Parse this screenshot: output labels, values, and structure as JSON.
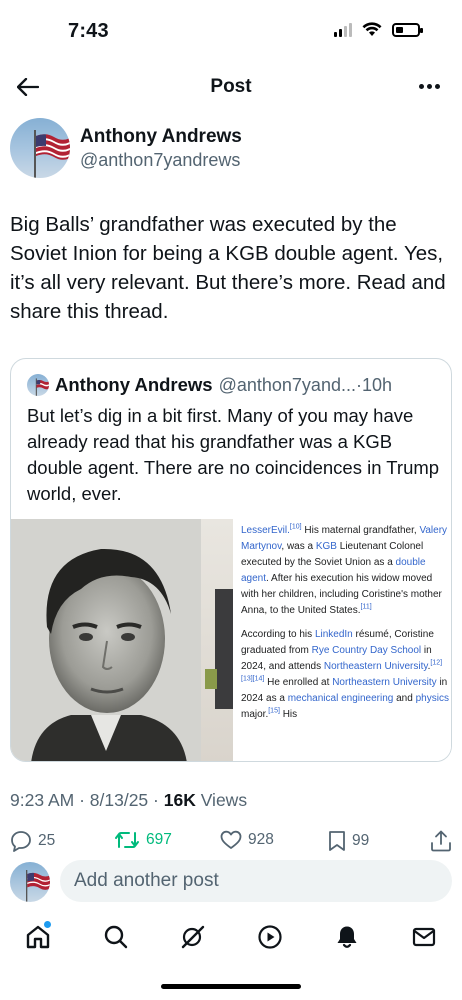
{
  "status_bar": {
    "time": "7:43",
    "battery_level": 0.35
  },
  "header": {
    "title": "Post",
    "back_icon": "arrow-left-icon",
    "more_icon": "more-dots-icon"
  },
  "author": {
    "name": "Anthony Andrews",
    "handle": "@anthon7yandrews"
  },
  "post": {
    "text": "Big Balls’ grandfather was executed by the Soviet Inion for being a KGB double agent. Yes, it’s all very relevant. But there’s more. Read and share this thread."
  },
  "quote": {
    "name": "Anthony Andrews",
    "handle": "@anthon7yand...",
    "separator": "·",
    "time": "10h",
    "text": "But let’s dig in a bit first. Many of you may have already read that his grandfather was a KGB double agent. There are no coincidences in Trump world, ever.",
    "wiki": {
      "p1": {
        "a": "LesserEvil.",
        "s1": "[10]",
        "b": " His maternal grandfather, ",
        "c": "Valery Martynov",
        "d": ", was a ",
        "e": "KGB",
        "f": " Lieutenant Colonel executed by the Soviet Union as a ",
        "g": "double agent",
        "h": ". After his execution his widow moved with her children, including Coristine's mother Anna, to the United States.",
        "s2": "[11]"
      },
      "p2": {
        "a": "According to his ",
        "b": "LinkedIn",
        "c": " résumé, Coristine graduated from ",
        "d": "Rye Country Day School",
        "e": " in 2024, and attends ",
        "f": "Northeastern University",
        "g": ".",
        "s1": "[12][13][14]",
        "h": " He enrolled at ",
        "i": "Northeastern University",
        "j": " in 2024 as a ",
        "k": "mechanical engineering",
        "l": " and ",
        "m": "physics",
        "n": " major.",
        "s2": "[15]",
        "o": " His"
      }
    }
  },
  "meta": {
    "time": "9:23 AM",
    "sep1": " · ",
    "date": "8/13/25",
    "sep2": " · ",
    "views_count": "16K",
    "views_label": " Views"
  },
  "actions": {
    "replies": "25",
    "reposts": "697",
    "likes": "928",
    "bookmarks": "99",
    "repost_color": "#00ba7c"
  },
  "reply": {
    "placeholder": "Add another post"
  },
  "tabs": [
    "home-icon",
    "search-icon",
    "grok-icon",
    "video-icon",
    "notifications-icon",
    "messages-icon"
  ],
  "colors": {
    "accent": "#1d9bf0",
    "text": "#0f1419",
    "secondary": "#536471",
    "link": "#3366cc"
  }
}
